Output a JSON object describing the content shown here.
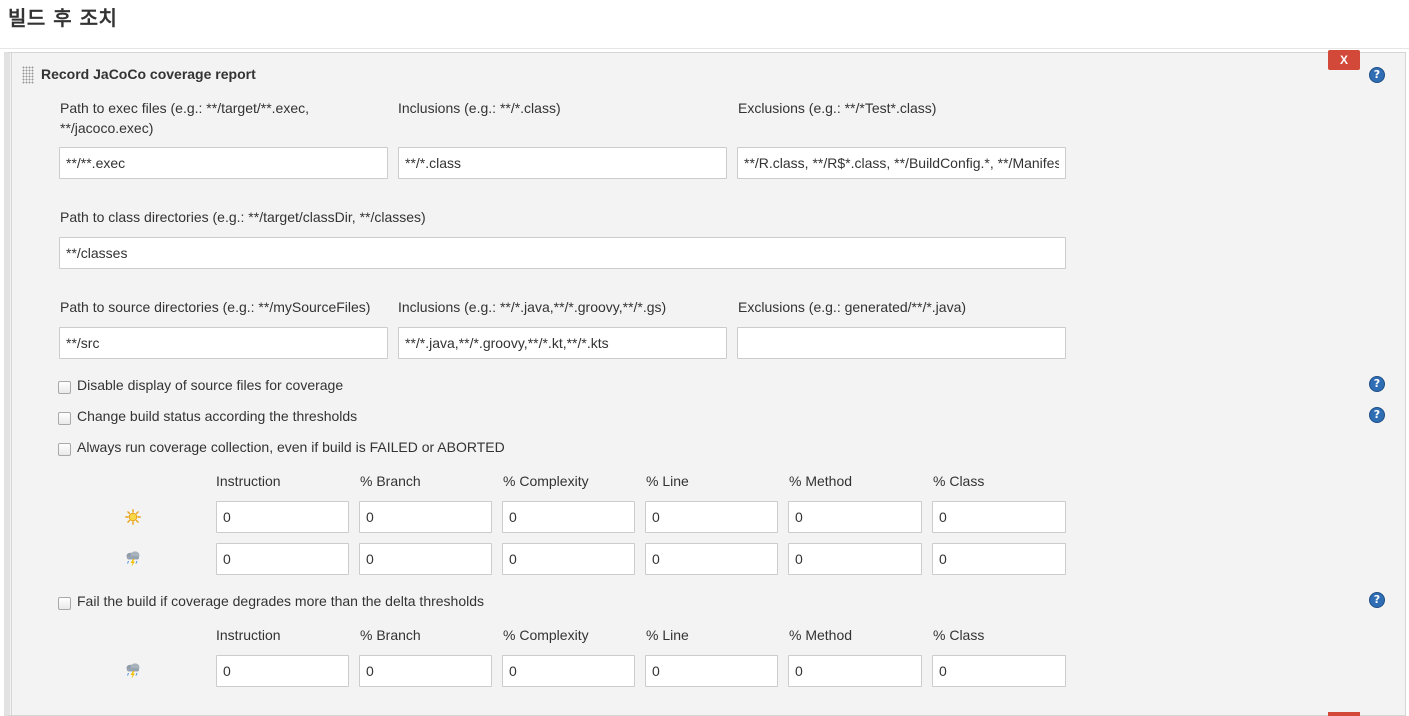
{
  "section_title": "빌드 후 조치",
  "plugin": {
    "title": "Record JaCoCo coverage report",
    "delete_label": "X"
  },
  "fields": {
    "exec_path": {
      "label_line1": "Path to exec files (e.g.: **/target/**.exec,",
      "label_line2": "**/jacoco.exec)",
      "value": "**/**.exec"
    },
    "class_inclusions": {
      "label": "Inclusions (e.g.: **/*.class)",
      "value": "**/*.class"
    },
    "class_exclusions": {
      "label": "Exclusions (e.g.: **/*Test*.class)",
      "value": "**/R.class, **/R$*.class, **/BuildConfig.*, **/Manifest*.*"
    },
    "class_dirs": {
      "label": "Path to class directories (e.g.: **/target/classDir, **/classes)",
      "value": "**/classes"
    },
    "source_dirs": {
      "label": "Path to source directories (e.g.: **/mySourceFiles)",
      "value": "**/src"
    },
    "source_inclusions": {
      "label": "Inclusions (e.g.: **/*.java,**/*.groovy,**/*.gs)",
      "value": "**/*.java,**/*.groovy,**/*.kt,**/*.kts"
    },
    "source_exclusions": {
      "label": "Exclusions (e.g.: generated/**/*.java)",
      "value": ""
    }
  },
  "checkboxes": {
    "disable_source": "Disable display of source files for coverage",
    "change_status": "Change build status according the thresholds",
    "always_run": "Always run coverage collection, even if build is FAILED or ABORTED",
    "fail_delta": "Fail the build if coverage degrades more than the delta thresholds"
  },
  "threshold_headers": [
    "Instruction",
    "% Branch",
    "% Complexity",
    "% Line",
    "% Method",
    "% Class"
  ],
  "thresholds": {
    "healthy": [
      "0",
      "0",
      "0",
      "0",
      "0",
      "0"
    ],
    "unhealthy": [
      "0",
      "0",
      "0",
      "0",
      "0",
      "0"
    ],
    "delta": [
      "0",
      "0",
      "0",
      "0",
      "0",
      "0"
    ]
  },
  "icons": {
    "healthy": "sun-icon",
    "unhealthy": "storm-icon",
    "help": "help-icon",
    "accent_color": "#d24939",
    "help_color": "#2f6db4"
  }
}
